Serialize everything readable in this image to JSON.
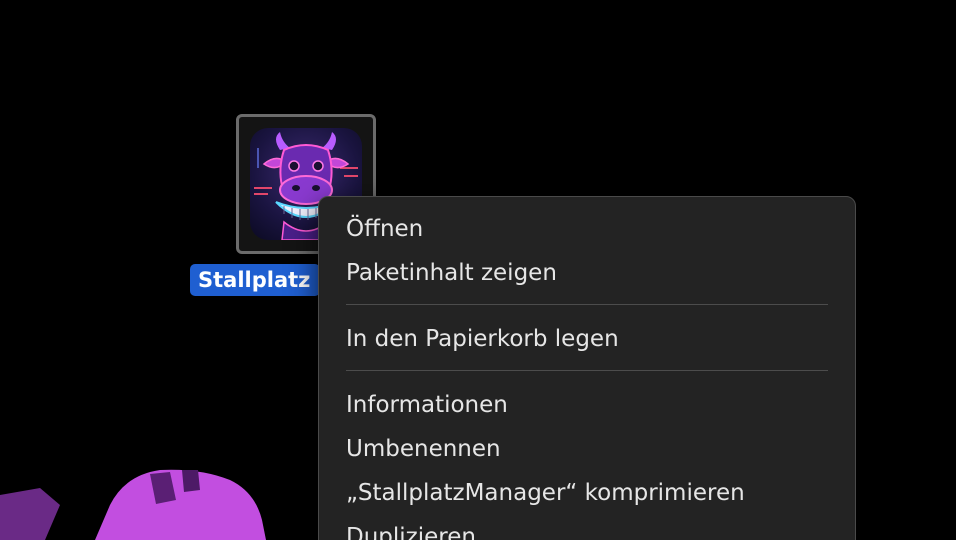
{
  "desktop": {
    "selected_item": {
      "label": "StallplatzManager",
      "visible_label": "Stallplatz",
      "icon": "cow-app-icon"
    }
  },
  "context_menu": {
    "items": [
      {
        "label": "Öffnen"
      },
      {
        "label": "Paketinhalt zeigen"
      },
      {
        "label": "In den Papierkorb legen"
      },
      {
        "label": "Informationen"
      },
      {
        "label": "Umbenennen"
      },
      {
        "label": "„StallplatzManager“ komprimieren"
      },
      {
        "label": "Duplizieren"
      }
    ]
  },
  "colors": {
    "background": "#000000",
    "menu_background": "#232323",
    "selection_label": "#1f5fd1",
    "text": "#e6e6e6",
    "wallpaper_accent": "#c24ee0"
  }
}
